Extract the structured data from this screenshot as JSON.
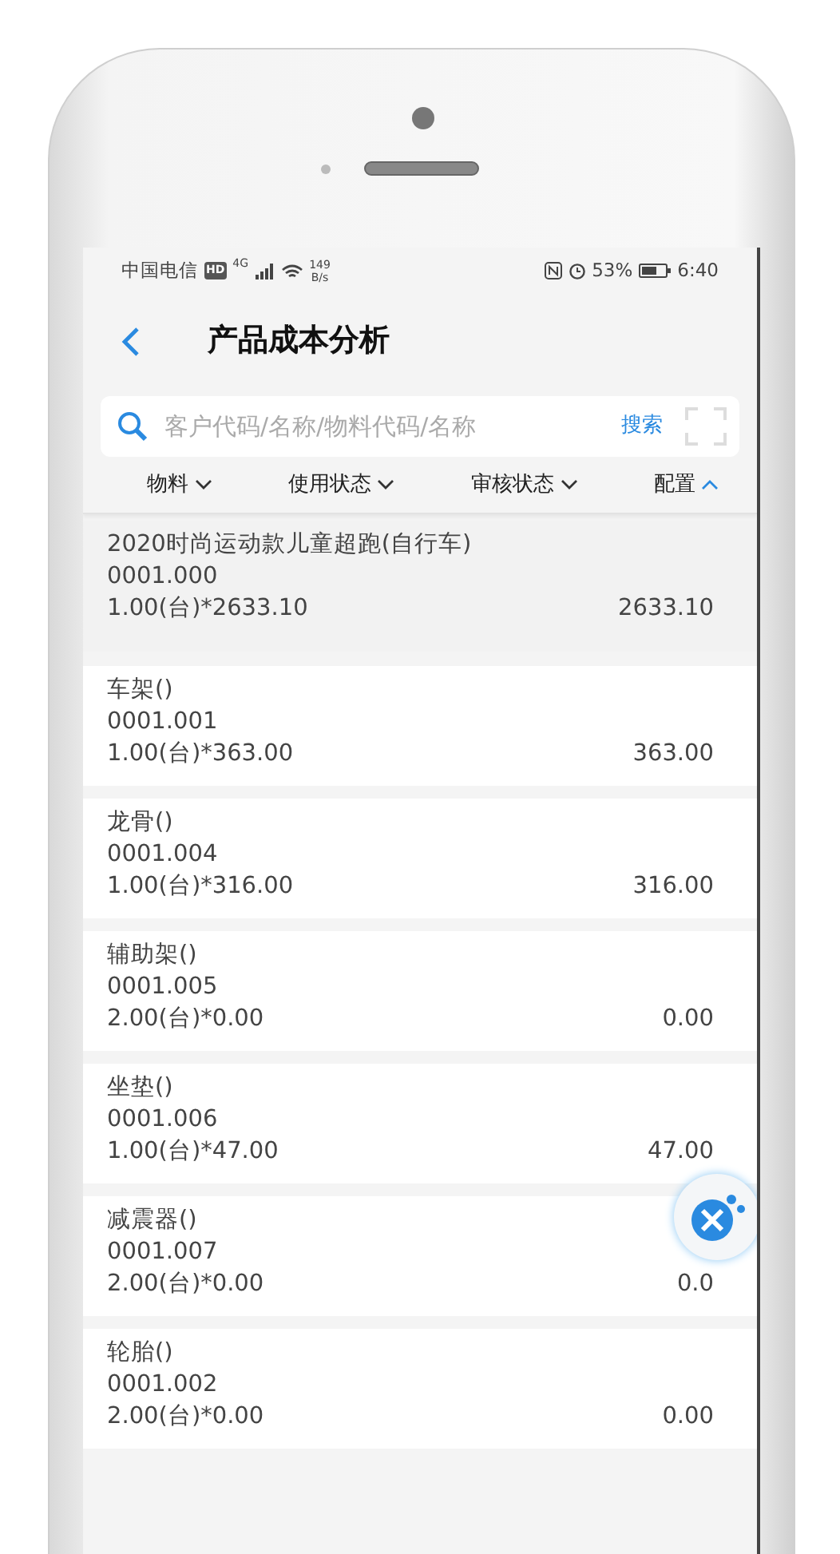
{
  "status_bar": {
    "carrier": "中国电信",
    "hd": "HD",
    "network": "4G",
    "speed_value": "149",
    "speed_unit": "B/s",
    "battery": "53%",
    "time": "6:40"
  },
  "header": {
    "title": "产品成本分析"
  },
  "search": {
    "placeholder": "客户代码/名称/物料代码/名称",
    "button": "搜索"
  },
  "filters": [
    {
      "label": "物料",
      "expanded": false
    },
    {
      "label": "使用状态",
      "expanded": false
    },
    {
      "label": "审核状态",
      "expanded": false
    },
    {
      "label": "配置",
      "expanded": true
    }
  ],
  "items": [
    {
      "name": "2020时尚运动款儿童超跑(自行车)",
      "code": "0001.000",
      "quantity": "1.00(台)*2633.10",
      "total": "2633.10",
      "selected": true
    },
    {
      "name": "车架()",
      "code": "0001.001",
      "quantity": "1.00(台)*363.00",
      "total": "363.00",
      "selected": false
    },
    {
      "name": "龙骨()",
      "code": "0001.004",
      "quantity": "1.00(台)*316.00",
      "total": "316.00",
      "selected": false
    },
    {
      "name": "辅助架()",
      "code": "0001.005",
      "quantity": "2.00(台)*0.00",
      "total": "0.00",
      "selected": false
    },
    {
      "name": "坐垫()",
      "code": "0001.006",
      "quantity": "1.00(台)*47.00",
      "total": "47.00",
      "selected": false
    },
    {
      "name": "减震器()",
      "code": "0001.007",
      "quantity": "2.00(台)*0.00",
      "total": "0.0",
      "selected": false
    },
    {
      "name": "轮胎()",
      "code": "0001.002",
      "quantity": "2.00(台)*0.00",
      "total": "0.00",
      "selected": false
    }
  ]
}
